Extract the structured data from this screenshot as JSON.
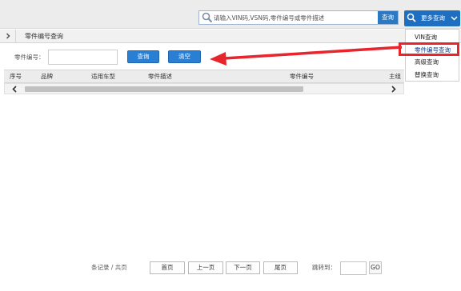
{
  "header": {
    "search_placeholder": "请输入VIN码,VSN码,零件编号或零件描述",
    "search_button": "查询",
    "more_button": "更多查询"
  },
  "dropdown": {
    "items": [
      {
        "label": "VIN查询"
      },
      {
        "label": "零件编号查询",
        "active": true
      },
      {
        "label": "高级查询"
      },
      {
        "label": "替换查询"
      }
    ]
  },
  "breadcrumb": {
    "title": "零件编号查询"
  },
  "form": {
    "label": "零件编号：",
    "value": "",
    "query_button": "查询",
    "clear_button": "清空"
  },
  "table": {
    "columns": [
      "序号",
      "品牌",
      "适用车型",
      "零件描述",
      "零件编号",
      "主组"
    ]
  },
  "pagination": {
    "summary": "条记录 / 共页",
    "first": "首页",
    "prev": "上一页",
    "next": "下一页",
    "last": "尾页",
    "jump_label": "跳转到：",
    "go": "GO"
  },
  "colors": {
    "accent_blue": "#2a7fd3",
    "highlight_red": "#e8252d"
  }
}
